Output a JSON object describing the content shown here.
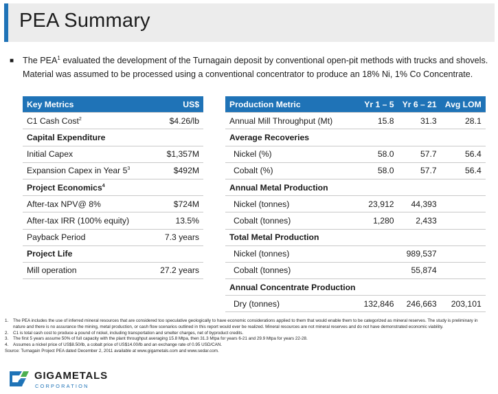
{
  "title": "PEA Summary",
  "intro": {
    "part1": "The PEA",
    "sup": "1",
    "part2": " evaluated the development of the Turnagain deposit by conventional open-pit methods with trucks and shovels. Material was assumed to be processed using a conventional concentrator to produce an 18% Ni, 1% Co Concentrate."
  },
  "key_metrics": {
    "headers": [
      "Key Metrics",
      "US$"
    ],
    "rows": [
      {
        "label": "C1 Cash Cost",
        "sup": "2",
        "value": "$4.26/lb"
      },
      {
        "label": "Capital Expenditure",
        "value": ""
      },
      {
        "label": "Initial Capex",
        "value": "$1,357M"
      },
      {
        "label": "Expansion Capex in Year 5",
        "sup": "3",
        "value": "$492M"
      },
      {
        "label": "Project Economics",
        "sup": "4",
        "value": ""
      },
      {
        "label": "After-tax NPV@ 8%",
        "value": "$724M"
      },
      {
        "label": "After-tax IRR (100% equity)",
        "value": "13.5%"
      },
      {
        "label": "Payback Period",
        "value": "7.3 years"
      },
      {
        "label": "Project Life",
        "value": ""
      },
      {
        "label": "Mill operation",
        "value": "27.2 years"
      }
    ]
  },
  "production": {
    "headers": [
      "Production Metric",
      "Yr 1 – 5",
      "Yr 6 – 21",
      "Avg LOM"
    ],
    "rows": [
      {
        "label": "Annual Mill Throughput (Mt)",
        "v1": "15.8",
        "v2": "31.3",
        "v3": "28.1"
      },
      {
        "label": "Average Recoveries",
        "v1": "",
        "v2": "",
        "v3": ""
      },
      {
        "label": "Nickel (%)",
        "v1": "58.0",
        "v2": "57.7",
        "v3": "56.4"
      },
      {
        "label": "Cobalt (%)",
        "v1": "58.0",
        "v2": "57.7",
        "v3": "56.4"
      },
      {
        "label": "Annual Metal Production",
        "v1": "",
        "v2": "",
        "v3": ""
      },
      {
        "label": "Nickel (tonnes)",
        "v1": "23,912",
        "v2": "44,393",
        "v3": ""
      },
      {
        "label": "Cobalt (tonnes)",
        "v1": "1,280",
        "v2": "2,433",
        "v3": ""
      },
      {
        "label": "Total Metal Production",
        "v1": "",
        "v2": "",
        "v3": ""
      },
      {
        "label": "Nickel (tonnes)",
        "total": "989,537"
      },
      {
        "label": "Cobalt (tonnes)",
        "total": "55,874"
      },
      {
        "label": "Annual Concentrate Production",
        "v1": "",
        "v2": "",
        "v3": ""
      },
      {
        "label": "Dry (tonnes)",
        "v1": "132,846",
        "v2": "246,663",
        "v3": "203,101"
      }
    ]
  },
  "footnotes": [
    {
      "n": "1.",
      "text": "The PEA includes the use of inferred mineral resources that are considered too speculative geologically to have economic considerations applied to them that would enable them to be categorized as mineral reserves. The study is preliminary in nature and there is no assurance the mining, metal production, or cash flow scenarios outlined in this report would ever be realized. Mineral resources are not mineral reserves and do not have demonstrated economic viability."
    },
    {
      "n": "2.",
      "text": "C1 is total cash cost to produce a pound of nickel, including transportation and smelter charges, net of byproduct credits."
    },
    {
      "n": "3.",
      "text": "The first 5 years assume 50% of full capacity with the plant throughput averaging 15.8 Mtpa, then 31.3 Mtpa for years 6-21 and 29.9 Mtpa for years 22-28."
    },
    {
      "n": "4.",
      "text": "Assumes a nickel price of US$8.50/lb, a cobalt price of US$14.00/lb and an exchange rate of 0.95 USD/CAN."
    }
  ],
  "source": "Source: Turnagain Project PEA dated December 2, 2011 available at www.gigametals.com and www.sedar.com.",
  "logo": {
    "name": "GIGAMETALS",
    "sub": "CORPORATION",
    "color_blue": "#1f73b7",
    "color_green": "#4caf50"
  }
}
